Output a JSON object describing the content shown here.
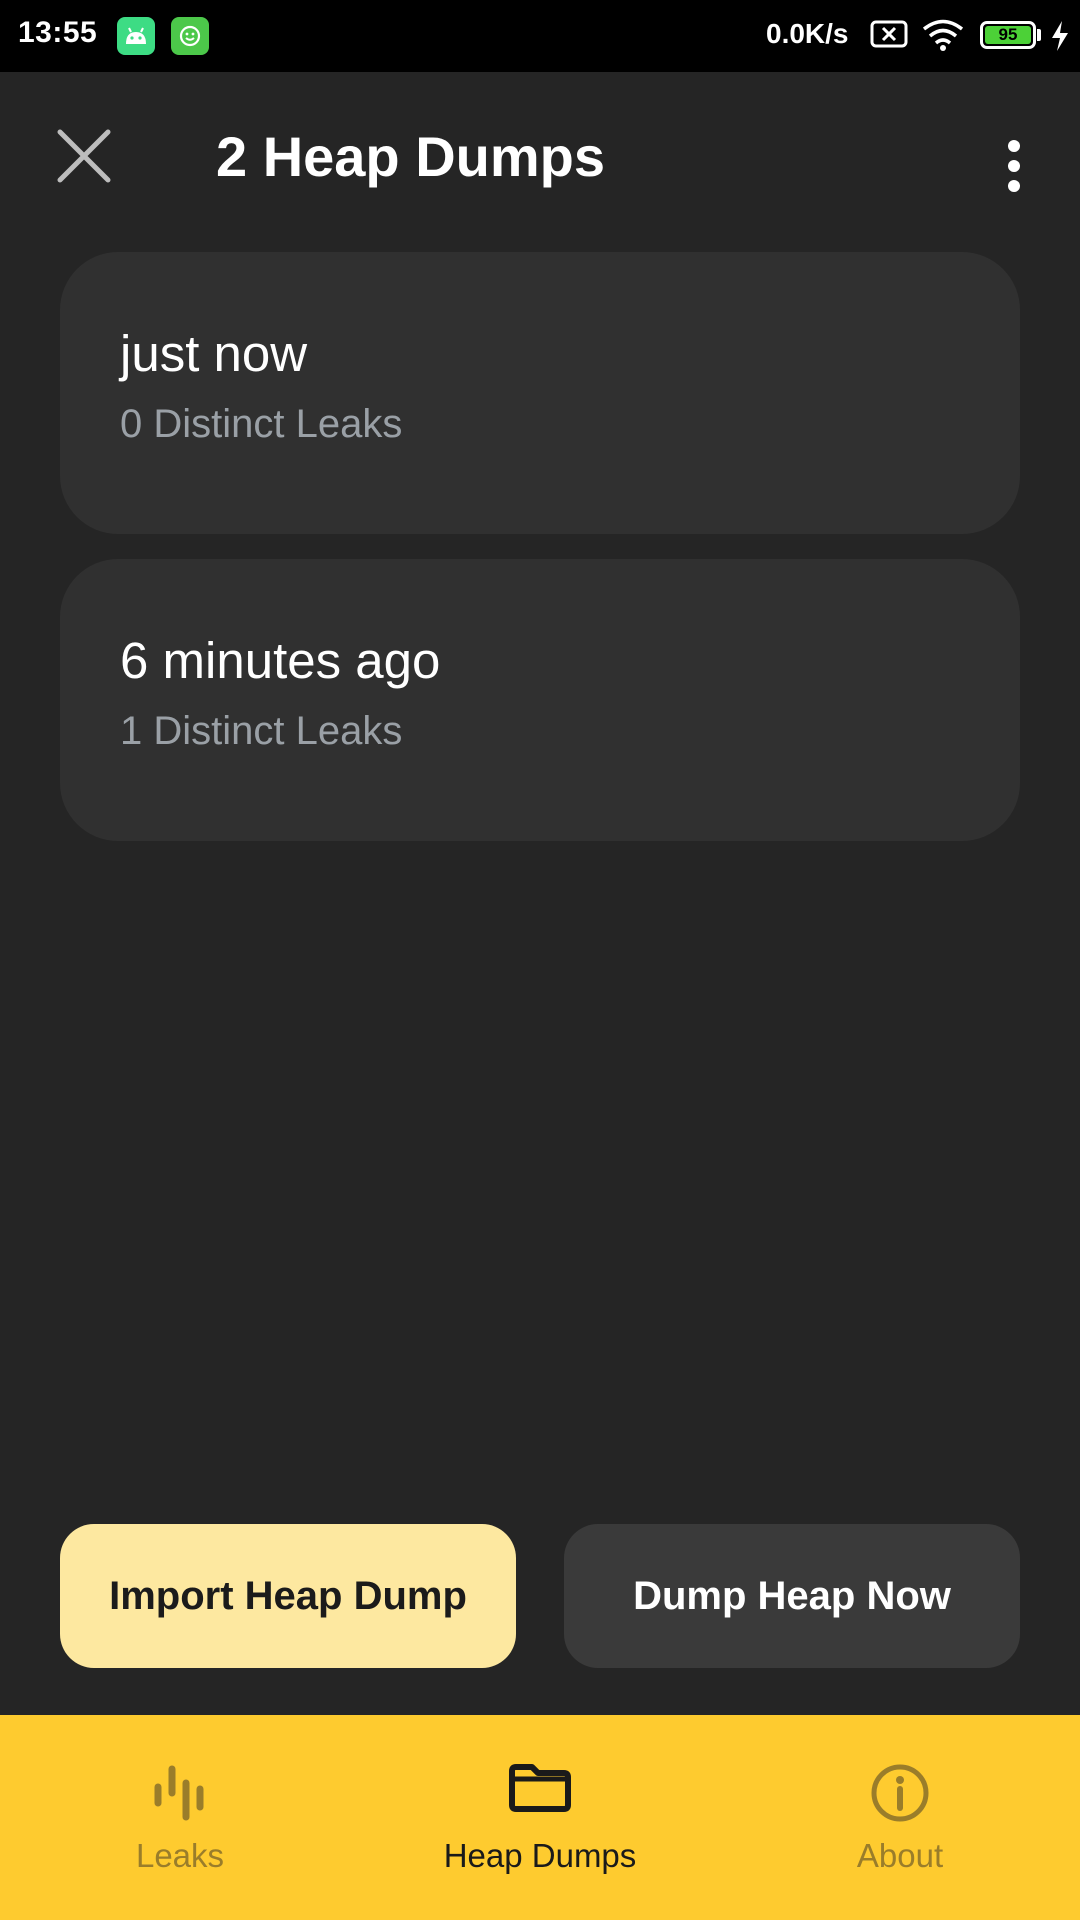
{
  "status_bar": {
    "time": "13:55",
    "net_speed": "0.0K/s",
    "battery_level": "95",
    "icons": [
      "android-icon",
      "smile-icon",
      "sim-off-icon",
      "wifi-icon",
      "battery-icon",
      "charging-icon"
    ]
  },
  "top_bar": {
    "title": "2 Heap Dumps",
    "close_icon": "close-icon",
    "menu_icon": "more-vert-icon"
  },
  "heap_dumps": [
    {
      "time": "just now",
      "leaks": "0 Distinct Leaks"
    },
    {
      "time": "6 minutes ago",
      "leaks": "1 Distinct Leaks"
    }
  ],
  "actions": {
    "import_label": "Import Heap Dump",
    "dump_label": "Dump Heap Now"
  },
  "bottom_nav": {
    "items": [
      {
        "label": "Leaks",
        "icon": "leaks-icon",
        "active": false
      },
      {
        "label": "Heap Dumps",
        "icon": "folder-icon",
        "active": true
      },
      {
        "label": "About",
        "icon": "info-icon",
        "active": false
      }
    ]
  },
  "colors": {
    "background": "#252525",
    "card": "#303030",
    "accent": "#fecb2f",
    "import_button": "#fde8a0",
    "dump_button": "#3a3a3a",
    "subtext": "#9aa0a6"
  }
}
